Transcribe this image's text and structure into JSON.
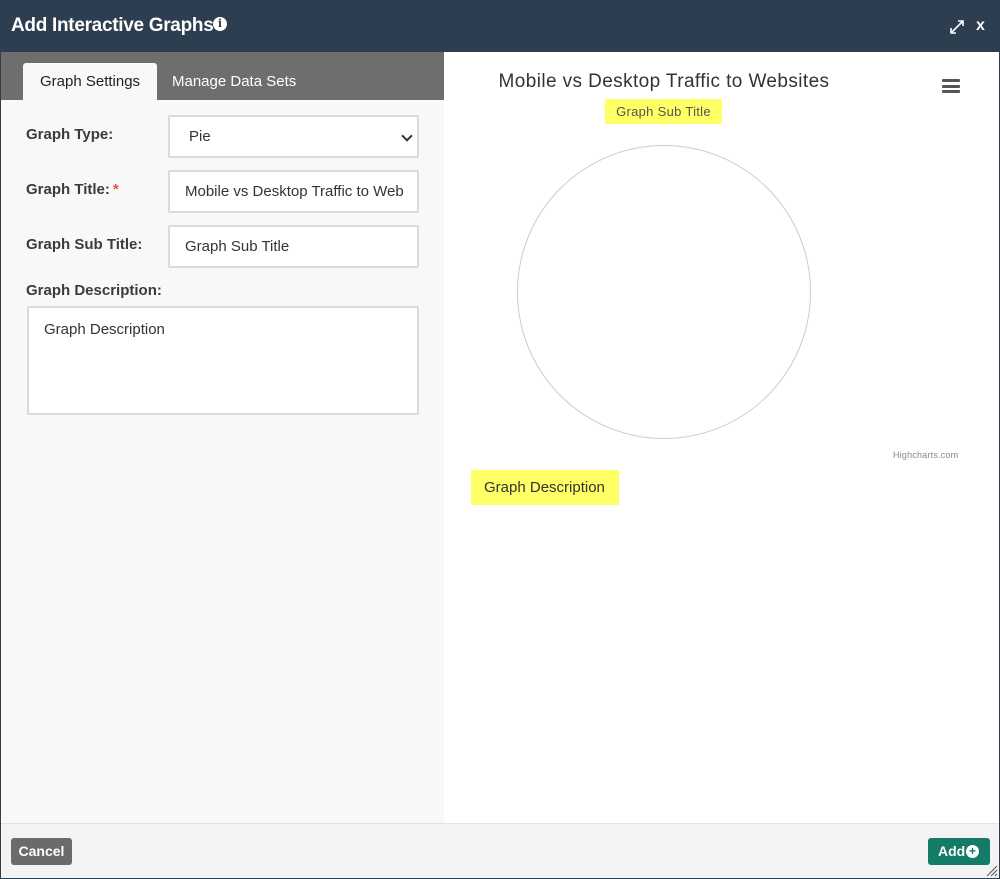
{
  "dialog": {
    "title": "Add Interactive Graphs",
    "close_label": "x",
    "cancel_label": "Cancel",
    "add_label": "Add",
    "colors": {
      "header": "#2d3e50",
      "add_button": "#137b68",
      "cancel_button": "#6b6b6b",
      "highlight": "#ffff66"
    }
  },
  "tabs": [
    {
      "label": "Graph Settings",
      "active": true
    },
    {
      "label": "Manage Data Sets",
      "active": false
    }
  ],
  "form": {
    "graph_type": {
      "label": "Graph Type:",
      "value": "Pie"
    },
    "graph_title": {
      "label": "Graph Title:",
      "required_mark": "*",
      "value": "Mobile vs Desktop Traffic to Web"
    },
    "graph_subtitle": {
      "label": "Graph Sub Title:",
      "value": "Graph Sub Title"
    },
    "graph_description": {
      "label": "Graph Description:",
      "value": "Graph Description"
    }
  },
  "preview": {
    "title": "Mobile vs Desktop Traffic to Websites",
    "subtitle": "Graph Sub Title",
    "description": "Graph Description",
    "credits": "Highcharts.com",
    "menu_icon": "hamburger-icon"
  },
  "chart_data": {
    "type": "pie",
    "title": "Mobile vs Desktop Traffic to Websites",
    "subtitle": "Graph Sub Title",
    "categories": [],
    "values": []
  }
}
